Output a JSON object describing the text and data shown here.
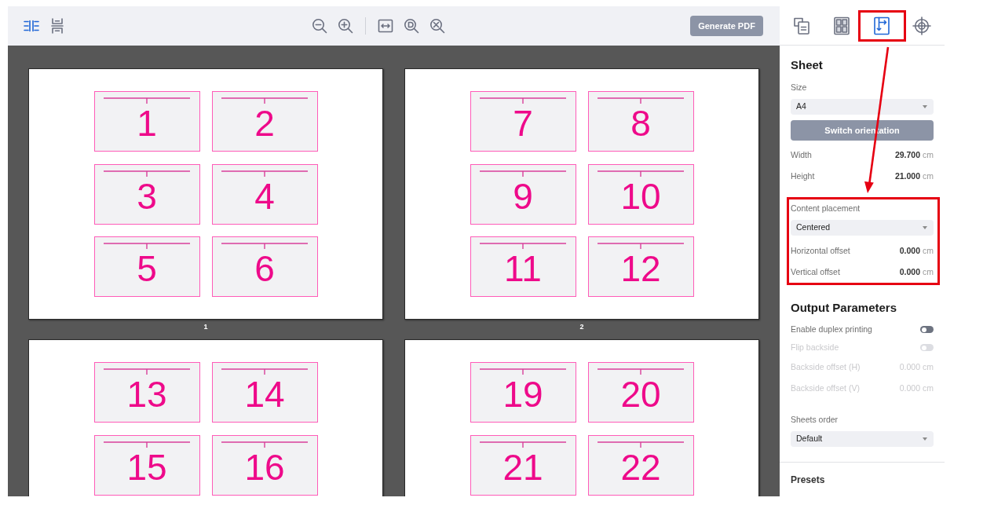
{
  "toolbar": {
    "view_modes": [
      {
        "kind": "columns",
        "selected": true
      },
      {
        "kind": "rows",
        "selected": false
      }
    ],
    "zoom_tools": [
      {
        "kind": "zoom-out"
      },
      {
        "kind": "zoom-in"
      }
    ],
    "fit_tools": [
      {
        "kind": "fit-width"
      },
      {
        "kind": "actual-size"
      },
      {
        "kind": "fit-page"
      }
    ],
    "generate_button": "Generate PDF"
  },
  "pages": [
    {
      "label": "1",
      "cells": [
        "1",
        "2",
        "3",
        "4",
        "5",
        "6"
      ]
    },
    {
      "label": "2",
      "cells": [
        "7",
        "8",
        "9",
        "10",
        "11",
        "12"
      ]
    },
    {
      "cells": [
        "13",
        "14",
        "15",
        "16"
      ]
    },
    {
      "cells": [
        "19",
        "20",
        "21",
        "22"
      ]
    }
  ],
  "panel": {
    "tabs": [
      {
        "kind": "pages",
        "selected": false,
        "highlighted": false
      },
      {
        "kind": "grid",
        "selected": false,
        "highlighted": false
      },
      {
        "kind": "layout",
        "selected": true,
        "highlighted": true
      },
      {
        "kind": "target",
        "selected": false,
        "highlighted": false
      }
    ],
    "sections": [
      {
        "title": "Sheet",
        "items": [
          {
            "kind": "label",
            "text": "Size"
          },
          {
            "kind": "select",
            "value": "A4"
          },
          {
            "kind": "button",
            "text": "Switch orientation"
          },
          {
            "kind": "value",
            "label": "Width",
            "value": "29.700",
            "unit": "cm",
            "disabled": false
          },
          {
            "kind": "value",
            "label": "Height",
            "value": "21.000",
            "unit": "cm",
            "disabled": false
          },
          {
            "kind": "group",
            "highlighted": true,
            "items": [
              {
                "kind": "label",
                "text": "Content placement"
              },
              {
                "kind": "select",
                "value": "Centered"
              },
              {
                "kind": "value",
                "label": "Horizontal offset",
                "value": "0.000",
                "unit": "cm",
                "disabled": false
              },
              {
                "kind": "value",
                "label": "Vertical offset",
                "value": "0.000",
                "unit": "cm",
                "disabled": false
              }
            ]
          }
        ]
      },
      {
        "title": "Output Parameters",
        "items": [
          {
            "kind": "toggle",
            "label": "Enable duplex printing",
            "on": false,
            "disabled": false
          },
          {
            "kind": "toggle",
            "label": "Flip backside",
            "on": false,
            "disabled": true
          },
          {
            "kind": "value",
            "label": "Backside offset (H)",
            "value": "0.000",
            "unit": "cm",
            "disabled": true
          },
          {
            "kind": "value",
            "label": "Backside offset (V)",
            "value": "0.000",
            "unit": "cm",
            "disabled": true
          },
          {
            "kind": "label",
            "text": "Sheets order"
          },
          {
            "kind": "select",
            "value": "Default"
          }
        ]
      }
    ],
    "footer_title": "Presets"
  }
}
